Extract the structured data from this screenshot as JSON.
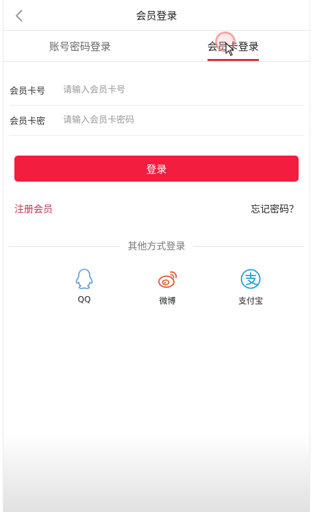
{
  "header": {
    "title": "会员登录",
    "back_icon": "chevron-left-icon"
  },
  "tabs": [
    {
      "label": "账号密码登录",
      "active": false
    },
    {
      "label": "会员卡登录",
      "active": true
    }
  ],
  "form": {
    "card_number": {
      "label": "会员卡号",
      "placeholder": "请输入会员卡号",
      "value": ""
    },
    "card_password": {
      "label": "会员卡密",
      "placeholder": "请输入会员卡密码",
      "value": ""
    }
  },
  "login_button": {
    "label": "登录",
    "color": "#f21d3f"
  },
  "links": {
    "register": "注册会员",
    "forgot_password": "忘记密码？"
  },
  "other_login": {
    "title": "其他方式登录",
    "methods": [
      {
        "label": "QQ",
        "icon": "qq-icon",
        "color": "#5b9bd5"
      },
      {
        "label": "微博",
        "icon": "weibo-icon",
        "color": "#e0572b"
      },
      {
        "label": "支付宝",
        "icon": "alipay-icon",
        "color": "#1f9fd8"
      }
    ]
  }
}
